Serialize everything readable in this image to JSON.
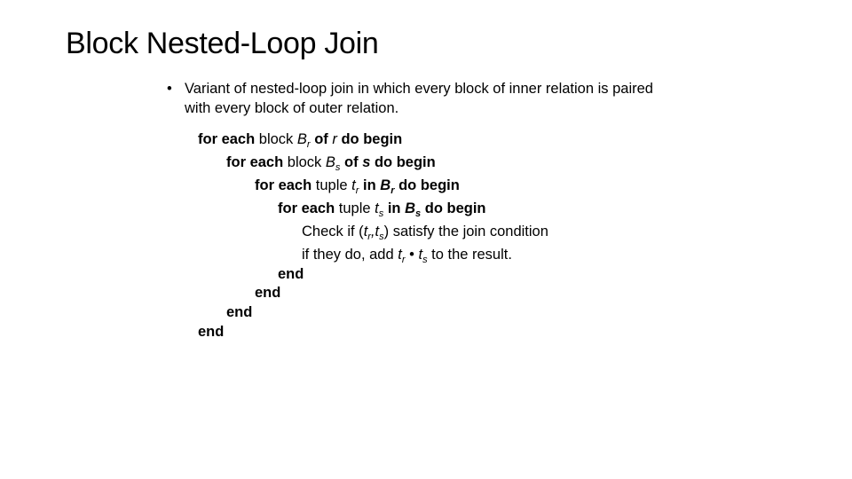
{
  "slide": {
    "title": "Block Nested-Loop Join",
    "bullets": [
      {
        "marker": "•",
        "text": "Variant of nested-loop join in which every block of inner relation is paired with every block of outer relation."
      }
    ]
  },
  "pseudocode": {
    "kw_for_each": "for each",
    "kw_do_begin": "do begin",
    "kw_of": "of",
    "kw_in": "in",
    "kw_end": "end",
    "word_block": "block",
    "word_tuple": "tuple",
    "var_B": "B",
    "var_t": "t",
    "sub_r": "r",
    "sub_s": "s",
    "rel_r": "r",
    "rel_s": "s",
    "check_prefix": "Check if (",
    "comma": ",",
    "check_suffix": ") satisfy the join condition",
    "add_prefix": "if they do, add ",
    "concat_op": " • ",
    "add_suffix": " to the result."
  }
}
